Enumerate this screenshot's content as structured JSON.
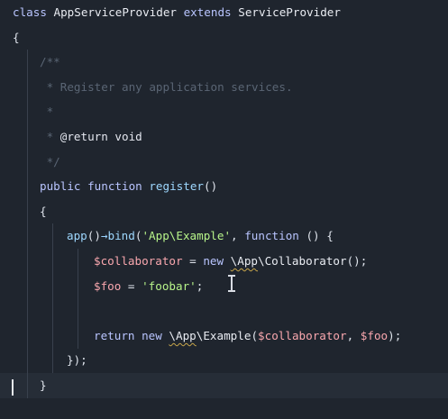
{
  "editor": {
    "language": "php",
    "lines": [
      {
        "indent": 0,
        "tokens": [
          {
            "t": "class ",
            "c": "kw"
          },
          {
            "t": "AppServiceProvider ",
            "c": "cls"
          },
          {
            "t": "extends ",
            "c": "kw"
          },
          {
            "t": "ServiceProvider",
            "c": "cls"
          }
        ]
      },
      {
        "indent": 0,
        "tokens": [
          {
            "t": "{",
            "c": "punc"
          }
        ]
      },
      {
        "indent": 1,
        "tokens": [
          {
            "t": "/**",
            "c": "cmt"
          }
        ]
      },
      {
        "indent": 1,
        "tokens": [
          {
            "t": " * Register any application services.",
            "c": "cmt"
          }
        ]
      },
      {
        "indent": 1,
        "tokens": [
          {
            "t": " *",
            "c": "cmt"
          }
        ]
      },
      {
        "indent": 1,
        "tokens": [
          {
            "t": " * ",
            "c": "cmt"
          },
          {
            "t": "@return ",
            "c": "cmt-tag"
          },
          {
            "t": "void",
            "c": "cmt-text"
          }
        ]
      },
      {
        "indent": 1,
        "tokens": [
          {
            "t": " */",
            "c": "cmt"
          }
        ]
      },
      {
        "indent": 1,
        "tokens": [
          {
            "t": "public ",
            "c": "kw"
          },
          {
            "t": "function ",
            "c": "kw"
          },
          {
            "t": "register",
            "c": "fn"
          },
          {
            "t": "()",
            "c": "punc"
          }
        ]
      },
      {
        "indent": 1,
        "tokens": [
          {
            "t": "{",
            "c": "punc"
          }
        ]
      },
      {
        "indent": 2,
        "tokens": [
          {
            "t": "app",
            "c": "fn"
          },
          {
            "t": "()",
            "c": "punc"
          },
          {
            "t": "→",
            "c": "op"
          },
          {
            "t": "bind",
            "c": "fn"
          },
          {
            "t": "(",
            "c": "punc"
          },
          {
            "t": "'App\\Example'",
            "c": "str"
          },
          {
            "t": ", ",
            "c": "punc"
          },
          {
            "t": "function ",
            "c": "kw"
          },
          {
            "t": "() {",
            "c": "punc"
          }
        ]
      },
      {
        "indent": 3,
        "tokens": [
          {
            "t": "$collaborator",
            "c": "var"
          },
          {
            "t": " = ",
            "c": "punc"
          },
          {
            "t": "new ",
            "c": "kw"
          },
          {
            "t": "\\App",
            "c": "cls",
            "sq": true
          },
          {
            "t": "\\Collaborator",
            "c": "cls"
          },
          {
            "t": "();",
            "c": "punc"
          }
        ]
      },
      {
        "indent": 3,
        "tokens": [
          {
            "t": "$foo",
            "c": "var"
          },
          {
            "t": " = ",
            "c": "punc"
          },
          {
            "t": "'foobar'",
            "c": "str"
          },
          {
            "t": ";",
            "c": "punc"
          }
        ]
      },
      {
        "indent": 3,
        "tokens": []
      },
      {
        "indent": 3,
        "tokens": [
          {
            "t": "return ",
            "c": "kw"
          },
          {
            "t": "new ",
            "c": "kw"
          },
          {
            "t": "\\App",
            "c": "cls",
            "sq": true
          },
          {
            "t": "\\Example",
            "c": "cls"
          },
          {
            "t": "(",
            "c": "punc"
          },
          {
            "t": "$collaborator",
            "c": "var"
          },
          {
            "t": ", ",
            "c": "punc"
          },
          {
            "t": "$foo",
            "c": "var"
          },
          {
            "t": ");",
            "c": "punc"
          }
        ]
      },
      {
        "indent": 2,
        "tokens": [
          {
            "t": "});",
            "c": "punc"
          }
        ]
      },
      {
        "indent": 1,
        "tokens": [
          {
            "t": "}",
            "c": "punc"
          }
        ],
        "current": true
      }
    ]
  }
}
